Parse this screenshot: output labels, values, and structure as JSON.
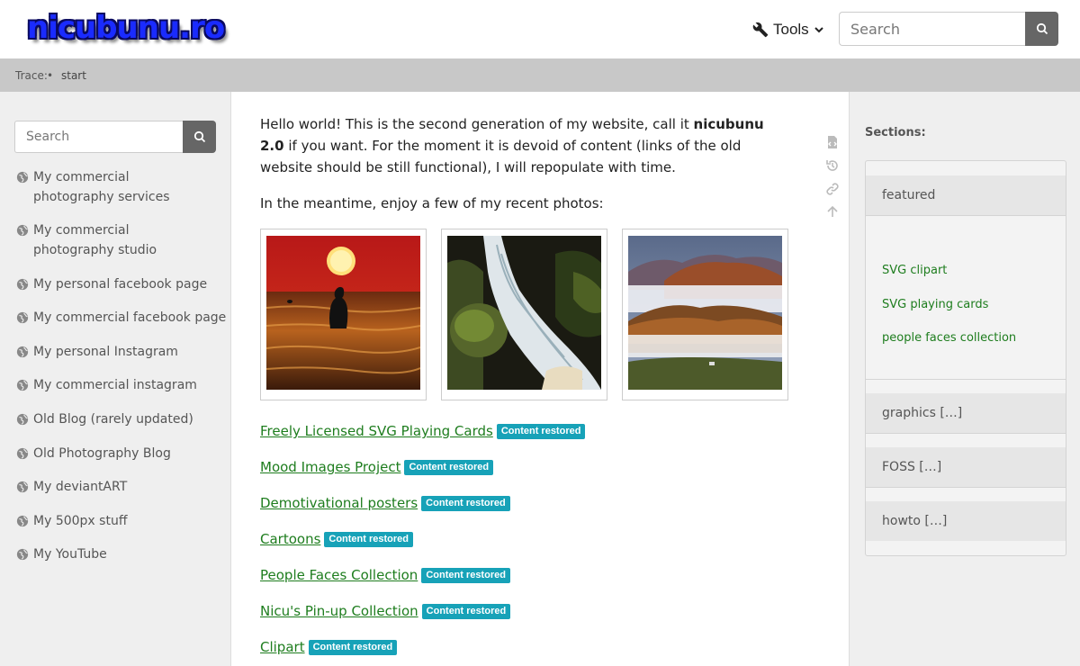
{
  "header": {
    "logo_text": "nicubunu.ro",
    "tools_label": "Tools",
    "search_placeholder": "Search"
  },
  "breadcrumb": {
    "label": "Trace:",
    "separator": "•",
    "current": "start"
  },
  "sidebar": {
    "search_placeholder": "Search",
    "links": [
      {
        "label": "My commercial photography services"
      },
      {
        "label": "My commercial photography studio"
      },
      {
        "label": "My personal facebook page"
      },
      {
        "label": "My commercial facebook page"
      },
      {
        "label": "My personal Instagram"
      },
      {
        "label": "My commercial instagram"
      },
      {
        "label": "Old Blog (rarely updated)"
      },
      {
        "label": "Old Photography Blog"
      },
      {
        "label": "My deviantART"
      },
      {
        "label": "My 500px stuff"
      },
      {
        "label": "My YouTube"
      }
    ]
  },
  "main": {
    "intro_part1": "Hello world! This is the second generation of my website, call it ",
    "intro_bold": "nicubunu 2.0",
    "intro_part2": " if you want. For the moment it is devoid of content (links of the old website should be still functional), I will repopulate with time.",
    "meantime": "In the meantime, enjoy a few of my recent photos:",
    "photos": [
      {
        "name": "sunset-swimmer-photo"
      },
      {
        "name": "waterfall-photo"
      },
      {
        "name": "foggy-hills-photo"
      }
    ],
    "projects": [
      {
        "title": "Freely Licensed SVG Playing Cards",
        "badge": "Content restored"
      },
      {
        "title": "Mood Images Project",
        "badge": "Content restored"
      },
      {
        "title": "Demotivational posters",
        "badge": "Content restored"
      },
      {
        "title": "Cartoons",
        "badge": "Content restored"
      },
      {
        "title": "People Faces Collection",
        "badge": "Content restored"
      },
      {
        "title": "Nicu's Pin-up Collection",
        "badge": "Content restored"
      },
      {
        "title": "Clipart",
        "badge": "Content restored"
      }
    ]
  },
  "page_tools": [
    "show-source-icon",
    "old-revisions-icon",
    "backlinks-icon",
    "back-to-top-icon"
  ],
  "rightbar": {
    "title": "Sections:",
    "sections": [
      {
        "label": "featured",
        "links": [
          "SVG clipart",
          "SVG playing cards",
          "people faces collection"
        ]
      },
      {
        "label": "graphics […]"
      },
      {
        "label": "FOSS […]"
      },
      {
        "label": "howto […]"
      }
    ]
  },
  "colors": {
    "link_green": "#1e7d1e",
    "badge_teal": "#17a2b8",
    "breadcrumb_gray": "#c8c8c8",
    "logo_blue": "#1a2bff"
  }
}
